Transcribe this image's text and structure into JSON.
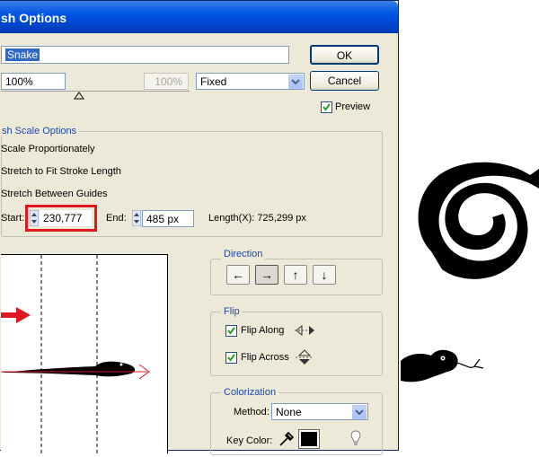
{
  "dialog": {
    "title": "sh Options",
    "name_value": "Snake",
    "ok_label": "OK",
    "cancel_label": "Cancel",
    "scale_value": "100%",
    "scale_value_disabled": "100%",
    "scale_mode": "Fixed",
    "preview_label": "Preview",
    "preview_checked": true
  },
  "scale_options": {
    "group_label": "sh Scale Options",
    "options": [
      "Scale Proportionately",
      "Stretch to Fit Stroke Length",
      "Stretch Between Guides"
    ],
    "start_label": "Start:",
    "start_value": "230,777",
    "end_label": "End:",
    "end_value": "485 px",
    "length_label": "Length(X): 725,299 px"
  },
  "direction": {
    "group_label": "Direction",
    "icons": [
      "arrow-left-icon",
      "arrow-right-icon",
      "arrow-up-icon",
      "arrow-down-icon"
    ],
    "glyphs": [
      "←",
      "→",
      "↑",
      "↓"
    ]
  },
  "flip": {
    "group_label": "Flip",
    "along_label": "Flip Along",
    "across_label": "Flip Across",
    "along_checked": true,
    "across_checked": true
  },
  "colorization": {
    "group_label": "Colorization",
    "method_label": "Method:",
    "method_value": "None",
    "key_color_label": "Key Color:",
    "key_color": "#000000"
  },
  "colors": {
    "title_bar": "#0055e5",
    "highlight_box": "#e0171f",
    "preview_arrow": "#e0171f"
  }
}
